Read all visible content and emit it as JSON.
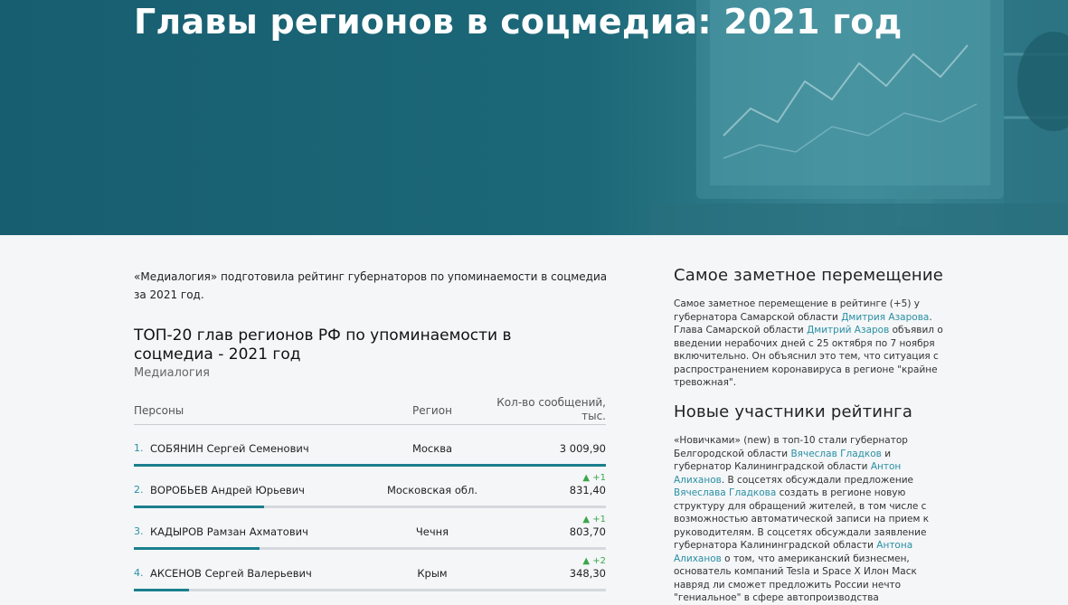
{
  "hero": {
    "title": "Главы регионов в соцмедиа: 2021 год",
    "background_color": "#1c6878"
  },
  "intro": {
    "text": "«Медиалогия» подготовила рейтинг губернаторов по упоминаемости в соцмедиа за 2021 год."
  },
  "table": {
    "title": "ТОП-20 глав регионов РФ по упоминаемости в соцмедиа - 2021 год",
    "source": "Медиалогия",
    "headers": {
      "person": "Персоны",
      "region": "Регион",
      "count": "Кол-во сообщений, тыс."
    },
    "rows": [
      {
        "rank": "1.",
        "name": "СОБЯНИН Сергей Семенович",
        "region": "Москва",
        "change": "",
        "value": "3 009,90",
        "share": 1.0
      },
      {
        "rank": "2.",
        "name": "ВОРОБЬЕВ Андрей Юрьевич",
        "region": "Московская обл.",
        "change": "▲ +1",
        "value": "831,40",
        "share": 0.276
      },
      {
        "rank": "3.",
        "name": "КАДЫРОВ Рамзан Ахматович",
        "region": "Чечня",
        "change": "▲ +1",
        "value": "803,70",
        "share": 0.267
      },
      {
        "rank": "4.",
        "name": "АКСЕНОВ Сергей Валерьевич",
        "region": "Крым",
        "change": "▲ +2",
        "value": "348,30",
        "share": 0.116
      }
    ],
    "accent_color": "#1a7f8e",
    "up_color": "#3aa64a"
  },
  "sidebar": {
    "section1": {
      "heading": "Самое заметное перемещение",
      "p1": "Самое заметное перемещение в рейтинге (+5) у губернатора Самарской области ",
      "l1": "Дмитрия Азарова",
      "p2": ". Глава Самарской области ",
      "l2": "Дмитрий Азаров",
      "p3": " объявил о введении нерабочих дней с 25 октября по 7 ноября включительно. Он объяснил это тем, что ситуация с распространением коронавируса в регионе \"крайне тревожная\"."
    },
    "section2": {
      "heading": "Новые участники рейтинга",
      "p1": "«Новичками» (new) в топ-10 стали губернатор Белгородской области ",
      "l1": "Вячеслав Гладков",
      "p2": " и губернатор Калининградской области ",
      "l2": "Антон Алиханов",
      "p3": ". В соцсетях обсуждали предложение ",
      "l3": "Вячеслава Гладкова",
      "p4": " создать в регионе новую структуру для обращений жителей, в том числе с возможностью автоматической записи на прием к руководителям. В соцсетях обсуждали заявление губернатора Калининградской области ",
      "l4": "Антона Алиханов",
      "p5": " о том, что американский бизнесмен, основатель компаний Tesla и Space X Илон Маск навряд ли сможет предложить России нечто \"гениальное\" в сфере автопроизводства"
    },
    "link_color": "#2a8fa3"
  }
}
